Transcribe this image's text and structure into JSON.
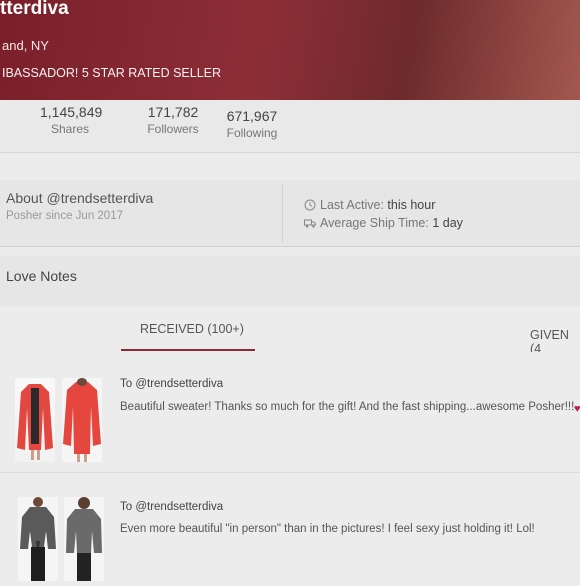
{
  "profile": {
    "name": "tterdiva",
    "location": "and, NY",
    "bio": "IBASSADOR! 5 STAR RATED SELLER"
  },
  "stats": {
    "shares": {
      "value": "1,145,849",
      "label": "Shares"
    },
    "followers": {
      "value": "171,782",
      "label": "Followers"
    },
    "following": {
      "value": "671,967",
      "label": "Following"
    }
  },
  "about": {
    "title": "About @trendsetterdiva",
    "since": "Posher since Jun 2017",
    "last_active_label": "Last Active:",
    "last_active_value": "this hour",
    "ship_time_label": "Average Ship Time:",
    "ship_time_value": "1 day"
  },
  "love_notes": {
    "title": "Love Notes",
    "tabs": {
      "received": "RECEIVED (100+)",
      "given": "GIVEN (4"
    },
    "notes": [
      {
        "to": "To @trendsetterdiva",
        "text": "Beautiful sweater! Thanks so much for the gift! And the fast shipping...awesome Posher!!!"
      },
      {
        "to": "To @trendsetterdiva",
        "text": "Even more beautiful \"in person\" than in the pictures! I feel sexy just holding it! Lol!"
      }
    ]
  },
  "colors": {
    "banner": "#7a1f2a",
    "accent": "#8b2c35",
    "heart": "#c2185b"
  }
}
